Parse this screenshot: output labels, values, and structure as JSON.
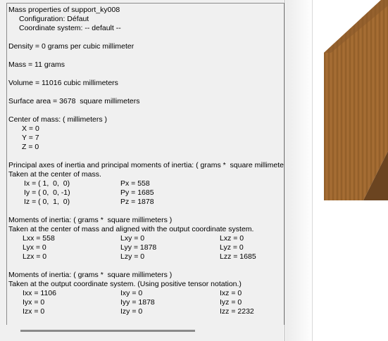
{
  "report": {
    "title": "Mass properties of support_ky008",
    "configuration": "Configuration: Défaut",
    "coordinate_system": "Coordinate system: -- default --",
    "density": "Density = 0 grams per cubic millimeter",
    "mass": "Mass = 11 grams",
    "volume": "Volume = 11016 cubic millimeters",
    "surface_area": "Surface area = 3678  square millimeters",
    "com_header": "Center of mass: ( millimeters )",
    "com_x": "X = 0",
    "com_y": "Y = 7",
    "com_z": "Z = 0",
    "principal_header": "Principal axes of inertia and principal moments of inertia: ( grams *  square millimeters )",
    "principal_taken": "Taken at the center of mass.",
    "ix": "Ix = ( 1,  0,  0)",
    "iy": "Iy = ( 0,  0, -1)",
    "iz": "Iz = ( 0,  1,  0)",
    "px": "Px = 558",
    "py": "Py = 1685",
    "pz": "Pz = 1878",
    "moi1_header": "Moments of inertia: ( grams *  square millimeters )",
    "moi1_taken": "Taken at the center of mass and aligned with the output coordinate system.",
    "lxx": "Lxx = 558",
    "lxy": "Lxy = 0",
    "lxz": "Lxz = 0",
    "lyx": "Lyx = 0",
    "lyy": "Lyy = 1878",
    "lyz": "Lyz = 0",
    "lzx": "Lzx = 0",
    "lzy": "Lzy = 0",
    "lzz": "Lzz = 1685",
    "moi2_header": "Moments of inertia: ( grams *  square millimeters )",
    "moi2_taken": "Taken at the output coordinate system. (Using positive tensor notation.)",
    "ixx": "Ixx = 1106",
    "ixy": "Ixy = 0",
    "ixz": "Ixz = 0",
    "iyx": "Iyx = 0",
    "iyy": "Iyy = 1878",
    "iyz": "Iyz = 0",
    "izx": "Izx = 0",
    "izy": "Izy = 0",
    "izz": "Izz = 2232"
  },
  "viewport": {
    "model_color_light": "#a0682f",
    "model_color_dark": "#6b4420",
    "model_color_top": "#8a5a2b"
  }
}
